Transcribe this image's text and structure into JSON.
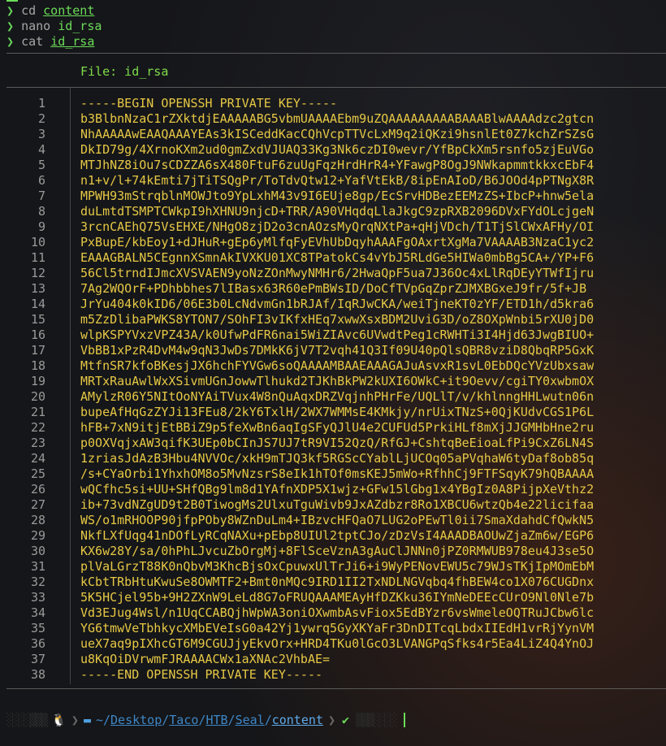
{
  "prompt_symbol": "❯",
  "commands": [
    {
      "cmd": "cd",
      "arg": "content"
    },
    {
      "cmd": "nano",
      "arg": "id_rsa"
    },
    {
      "cmd": "cat",
      "arg": "id_rsa"
    }
  ],
  "file_header": "File: id_rsa",
  "lines": [
    "-----BEGIN OPENSSH PRIVATE KEY-----",
    "b3BlbnNzaC1rZXktdjEAAAAABG5vbmUAAAAEbm9uZQAAAAAAAAABAAABlwAAAAdzc2gtcn",
    "NhAAAAAwEAAQAAAYEAs3kISCeddKacCQhVcpTTVcLxM9q2iQKzi9hsnlEt0Z7kchZrSZsG",
    "DkID79g/4XrnoKXm2ud0gmZxdVJUAQ33Kg3Nk6czDI0wevr/YfBpCkXm5rsnfo5zjEuVGo",
    "MTJhNZ8iOu7sCDZZA6sX480FtuF6zuUgFqzHrdHrR4+YFawgP8OgJ9NWkapmmtkkxcEbF4",
    "n1+v/l+74kEmti7jTiTSQgPr/ToTdvQtw12+YafVtEkB/8ipEnAIoD/B6JOOd4pPTNgX8R",
    "MPWH93mStrqblnMOWJto9YpLxhM43v9I6EUje8gp/EcSrvHDBezEEMzZS+IbcP+hnw5ela",
    "duLmtdTSMPTCWkpI9hXHNU9njcD+TRR/A90VHqdqLlaJkgC9zpRXB2096DVxFYdOLcjgeN",
    "3rcnCAEhQ75VsEHXE/NHgO8zjD2o3cnAOzsMyQrqNXtPa+qHjVDch/T1TjSlCWxAFHy/OI",
    "PxBupE/kbEoy1+dJHuR+gEp6yMlfqFyEVhUbDqyhAAAFgOAxrtXgMa7VAAAAB3NzaC1yc2",
    "EAAAGBALN5CEgnnXSmnAkIVXKU01XC8TPatokCs4vYbJ5RLdGe5HIWa0mbBg5CA+/YP+F6",
    "56Cl5trndIJmcXVSVAEN9yoNzZOnMwyNMHr6/2HwaQpF5ua7J36Oc4xLlRqDEyYTWfIjru",
    "7Ag2WQOrF+PDhbbhes7lIBasx63R60ePmBWsID/DoCfTVpGqZprZJMXBGxeJ9fr/5f+JB",
    "JrYu404k0kID6/06E3b0LcNdvmGn1bRJAf/IqRJwCKA/weiTjneKT0zYF/ETD1h/d5kra6",
    "m5ZzDlibaPWKS8YTON7/SOhFI3vIKfxHEq7xwwXsxBDM2UviG3D/oZ8OXpWnbi5rXU0jD0",
    "wlpKSPYVxzVPZ43A/k0UfwPdFR6nai5WiZIAvc6UVwdtPeg1cRWHTi3I4Hjd63JwgBIUO+",
    "VbBB1xPzR4DvM4w9qN3JwDs7DMkK6jV7T2vqh41Q3If09U40pQlsQBR8vziD8QbqRP5GxK",
    "MtfnSR7kfoBKesjJX6hchFYVGw6soQAAAAMBAAEAAAGAJuAsvxR1svL0EbDQcYVzUbxsaw",
    "MRTxRauAwlWxXSivmUGnJowwTlhukd2TJKhBkPW2kUXI6OWkC+it9Oevv/cgiTY0xwbmOX",
    "AMylzR06Y5NItOoNYAiTVux4W8nQuAqxDRZVqjnhPHrFe/UQLlT/v/khlnngHHLwutn06n",
    "bupeAfHqGzZYJi13FEu8/2kY6TxlH/2WX7WMMsE4KMkjy/nrUixTNzS+0QjKUdvCGS1P6L",
    "hFB+7xN9itjEtBBiZ9p5feXwBn6aqIgSFyQJlU4e2CUFUd5PrkiHLf8mXjJJGMHbHne2ru",
    "p0OXVqjxAW3qifK3UEp0bCInJS7UJ7tR9VI52QzQ/RfGJ+CshtqBeEioaLfPi9CxZ6LN4S",
    "1zriasJdAzB3Hbu4NVVOc/xkH9mTJQ3kf5RGScCYablLjUCOq05aPVqhaW6tyDaf8ob85q",
    "/s+CYaOrbi1YhxhOM8o5MvNzsrS8eIk1hTOf0msKEJ5mWo+RfhhCj9FTFSqyK79hQBAAAA",
    "wQCfhc5si+UU+SHfQBg9lm8d1YAfnXDP5X1wjz+GFw15lGbg1x4YBgIz0A8PijpXeVthz2",
    "ib+73vdNZgUD9t2B0TiwogMs2UlxuTguWivb9JxAZdbzr8Ro1XBCU6wtzQb4e22licifaa",
    "WS/o1mRHOOP90jfpPOby8WZnDuLm4+IBzvcHFQaO7LUG2oPEwTl0ii7SmaXdahdCfQwkN5",
    "NkfLXfUqg41nDOfLyRCqNAXu+pEbp8UIUl2tptCJo/zDzVsI4AAADBAOUwZjaZm6w/EGP6",
    "KX6w28Y/sa/0hPhLJvcuZbOrgMj+8FlSceVznA3gAuClJNNn0jPZ0RMWUB978eu4J3se5O",
    "plVaLGrzT88K0nQbvM3KhcBjsOxCpuwxUlTrJi6+i9WyPENovEWU5c79WJsTKjIpMOmEbM",
    "kCbtTRbHtuKwuSe8OWMTF2+Bmt0nMQc9IRD1II2TxNDLNGVqbq4fhBEW4co1X076CUGDnx",
    "5K5HCjel95b+9H2ZXnW9LeLd8G7oFRUQAAAMEAyHfDZKku36IYmNeDEEcCUrO9Nl0Nle7b",
    "Vd3EJug4Wsl/n1UqCCABQjhWpWA3oniOXwmbAsvFiox5EdBYzr6vsWmeleOQTRuJCbw6lc",
    "YG6tmwVeTbhkycXMbEVeIsG0a42Yj1ywrq5GyXKYaFr3DnDITcqLbdxIIEdH1vrRjYynVM",
    "ueX7aq9pIXhcGT6M9CGUJjyEkvOrx+HRD4TKu0lGcO3LVANGPqSfks4r5Ea4LiZ4Q4YnOJ",
    "u8KqOiDVrwmFJRAAAACWx1aXNAc2VhbAE=",
    "-----END OPENSSH PRIVATE KEY-----"
  ],
  "statusbar": {
    "linux_icon": "tux-icon",
    "folder_icon": "folder-icon",
    "path_prefix": "~/",
    "path_parts": [
      "Desktop",
      "Taco",
      "HTB",
      "Seal"
    ],
    "path_current": "content",
    "status_icon": "check-icon",
    "status_symbol": "✔"
  },
  "colors": {
    "prompt": "#6bdc59",
    "key_text": "#e6c845",
    "path": "#3d86c6"
  }
}
